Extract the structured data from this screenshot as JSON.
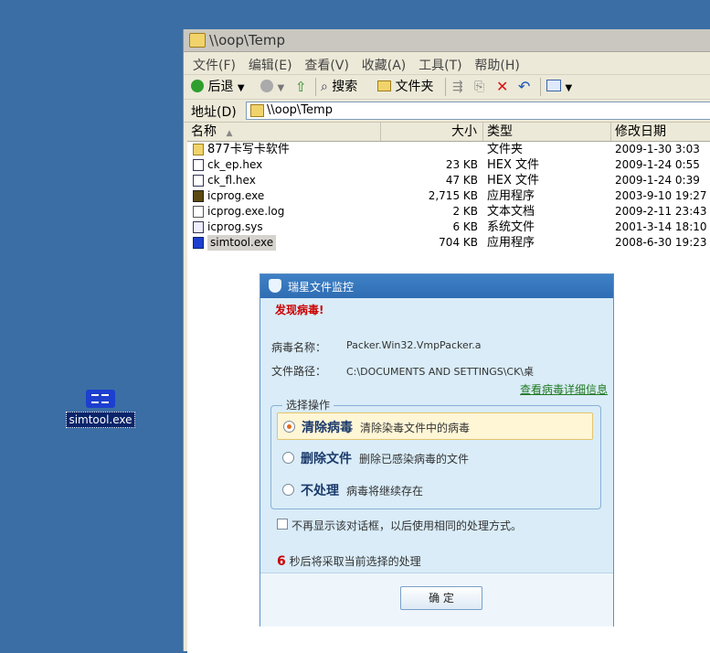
{
  "desktop": {
    "icon_label": "simtool.exe"
  },
  "window": {
    "title": "\\\\oop\\Temp",
    "menu": [
      "文件(F)",
      "编辑(E)",
      "查看(V)",
      "收藏(A)",
      "工具(T)",
      "帮助(H)"
    ],
    "toolbar": {
      "back": "后退",
      "search": "搜索",
      "folders": "文件夹"
    },
    "address": {
      "label": "地址(D)",
      "value": "\\\\oop\\Temp"
    },
    "columns": {
      "name": "名称",
      "size": "大小",
      "type": "类型",
      "date": "修改日期"
    },
    "files": [
      {
        "name": "877卡写卡软件",
        "size": "",
        "type": "文件夹",
        "date": "2009-1-30 3:03"
      },
      {
        "name": "ck_ep.hex",
        "size": "23 KB",
        "type": "HEX 文件",
        "date": "2009-1-24 0:55"
      },
      {
        "name": "ck_fl.hex",
        "size": "47 KB",
        "type": "HEX 文件",
        "date": "2009-1-24 0:39"
      },
      {
        "name": "icprog.exe",
        "size": "2,715 KB",
        "type": "应用程序",
        "date": "2003-9-10 19:27"
      },
      {
        "name": "icprog.exe.log",
        "size": "2 KB",
        "type": "文本文档",
        "date": "2009-2-11 23:43"
      },
      {
        "name": "icprog.sys",
        "size": "6 KB",
        "type": "系统文件",
        "date": "2001-3-14 18:10"
      },
      {
        "name": "simtool.exe",
        "size": "704 KB",
        "type": "应用程序",
        "date": "2008-6-30 19:23"
      }
    ]
  },
  "dialog": {
    "title": "瑞星文件监控",
    "alert": "发现病毒!",
    "virus_name_label": "病毒名称：",
    "virus_name": "Packer.Win32.VmpPacker.a",
    "path_label": "文件路径：",
    "path": "C:\\DOCUMENTS AND SETTINGS\\CK\\桌",
    "detail_link": "查看病毒详细信息",
    "group_title": "选择操作",
    "options": [
      {
        "title": "清除病毒",
        "desc": "清除染毒文件中的病毒",
        "selected": true
      },
      {
        "title": "删除文件",
        "desc": "删除已感染病毒的文件",
        "selected": false
      },
      {
        "title": "不处理",
        "desc": "病毒将继续存在",
        "selected": false
      }
    ],
    "no_show": "不再显示该对话框，以后使用相同的处理方式。",
    "countdown_num": "6",
    "countdown_text": " 秒后将采取当前选择的处理",
    "ok_label": "确 定"
  }
}
